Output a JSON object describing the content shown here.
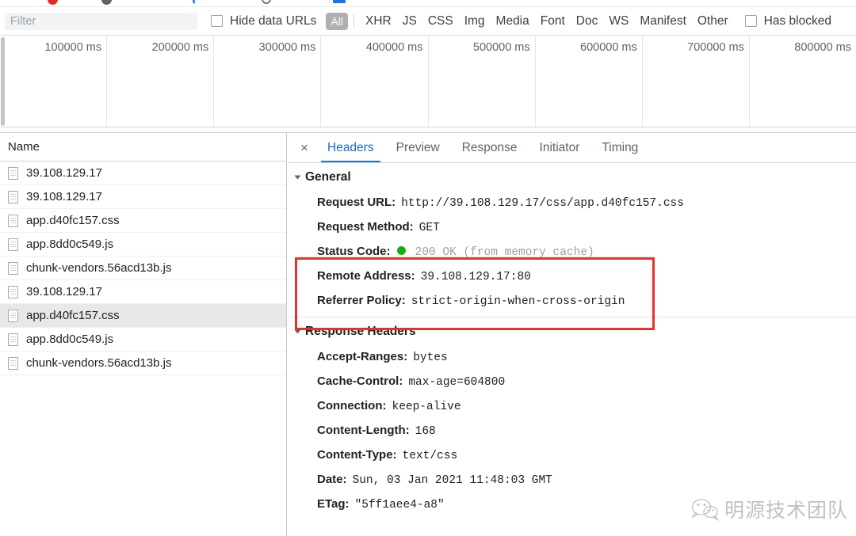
{
  "toolbar_icons": [
    {
      "name": "record-icon",
      "color": "#d93025"
    },
    {
      "name": "clear-icon",
      "color": "#5f6368"
    },
    {
      "name": "filter-icon",
      "color": "#1a73e8"
    },
    {
      "name": "search-icon",
      "color": "#70757a"
    },
    {
      "name": "import-har-icon",
      "color": "#1a73e8"
    }
  ],
  "filterbar": {
    "filter_placeholder": "Filter",
    "filter_value": "",
    "hide_data_urls_label": "Hide data URLs",
    "has_blocked_label": "Has blocked",
    "types": [
      "All",
      "XHR",
      "JS",
      "CSS",
      "Img",
      "Media",
      "Font",
      "Doc",
      "WS",
      "Manifest",
      "Other"
    ],
    "active_type": "All",
    "active_type_bg": "#b0b0b0"
  },
  "overview": {
    "ticks": [
      "100000 ms",
      "200000 ms",
      "300000 ms",
      "400000 ms",
      "500000 ms",
      "600000 ms",
      "700000 ms",
      "800000 ms"
    ]
  },
  "requests": {
    "column_header": "Name",
    "rows": [
      {
        "name": "39.108.129.17",
        "selected": false
      },
      {
        "name": "39.108.129.17",
        "selected": false
      },
      {
        "name": "app.d40fc157.css",
        "selected": false
      },
      {
        "name": "app.8dd0c549.js",
        "selected": false
      },
      {
        "name": "chunk-vendors.56acd13b.js",
        "selected": false
      },
      {
        "name": "39.108.129.17",
        "selected": false
      },
      {
        "name": "app.d40fc157.css",
        "selected": true
      },
      {
        "name": "app.8dd0c549.js",
        "selected": false
      },
      {
        "name": "chunk-vendors.56acd13b.js",
        "selected": false
      }
    ]
  },
  "detail": {
    "close_label": "×",
    "tabs": [
      {
        "label": "Headers",
        "active": true
      },
      {
        "label": "Preview",
        "active": false
      },
      {
        "label": "Response",
        "active": false
      },
      {
        "label": "Initiator",
        "active": false
      },
      {
        "label": "Timing",
        "active": false
      }
    ],
    "general": {
      "title": "General",
      "rows": [
        {
          "key": "Request URL:",
          "value": "http://39.108.129.17/css/app.d40fc157.css",
          "muted": false,
          "dot": false
        },
        {
          "key": "Request Method:",
          "value": "GET",
          "muted": false,
          "dot": false
        },
        {
          "key": "Status Code:",
          "value": "200 OK (from memory cache)",
          "muted": true,
          "dot": true,
          "dot_color": "#0bb50b"
        },
        {
          "key": "Remote Address:",
          "value": "39.108.129.17:80",
          "muted": false,
          "dot": false
        },
        {
          "key": "Referrer Policy:",
          "value": "strict-origin-when-cross-origin",
          "muted": false,
          "dot": false
        }
      ]
    },
    "response_headers": {
      "title": "Response Headers",
      "rows": [
        {
          "key": "Accept-Ranges:",
          "value": "bytes"
        },
        {
          "key": "Cache-Control:",
          "value": "max-age=604800"
        },
        {
          "key": "Connection:",
          "value": "keep-alive"
        },
        {
          "key": "Content-Length:",
          "value": "168"
        },
        {
          "key": "Content-Type:",
          "value": "text/css"
        },
        {
          "key": "Date:",
          "value": "Sun, 03 Jan 2021 11:48:03 GMT"
        },
        {
          "key": "ETag:",
          "value": "\"5ff1aee4-a8\""
        }
      ]
    },
    "annotation_box_color": "#e8312a"
  },
  "watermark": {
    "text": "明源技术团队",
    "logo": "wechat-logo"
  }
}
